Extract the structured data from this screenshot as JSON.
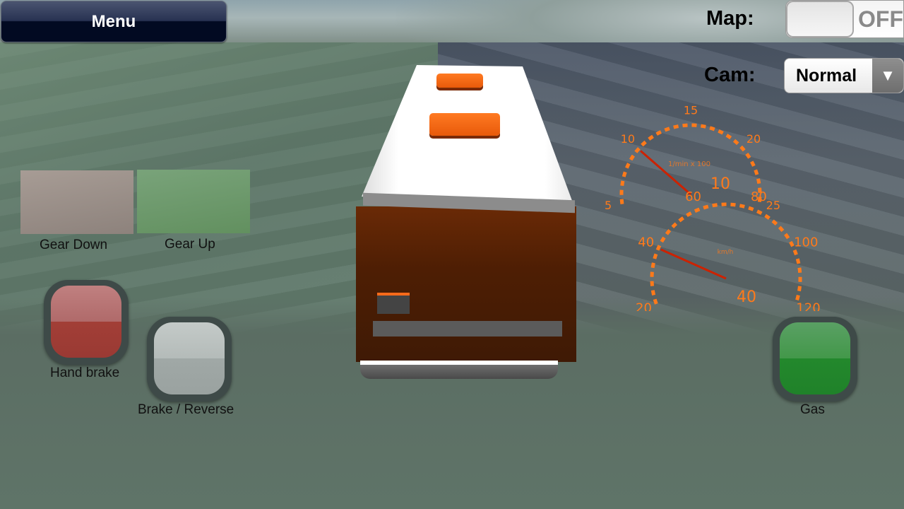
{
  "menu": {
    "label": "Menu"
  },
  "map": {
    "label": "Map:",
    "toggle_state": "OFF"
  },
  "cam": {
    "label": "Cam:",
    "selected": "Normal",
    "arrow_icon": "▼"
  },
  "controls": {
    "gear_down": {
      "label": "Gear Down",
      "color": "#9a8f89"
    },
    "gear_up": {
      "label": "Gear Up",
      "color": "#6e9a6c"
    },
    "hand_brake": {
      "label": "Hand brake",
      "color": "#a03a34"
    },
    "brake_reverse": {
      "label": "Brake / Reverse",
      "color": "#a9b0ae"
    },
    "gas": {
      "label": "Gas",
      "color": "#22882a"
    }
  },
  "tachometer": {
    "unit": "1/min x 100",
    "ticks": [
      "5",
      "10",
      "15",
      "20",
      "25"
    ],
    "min": 5,
    "max": 25,
    "value": 10,
    "readout": "10"
  },
  "speedometer": {
    "unit": "km/h",
    "ticks": [
      "20",
      "40",
      "60",
      "80",
      "100",
      "120"
    ],
    "min": 20,
    "max": 120,
    "value": 40,
    "readout": "40"
  },
  "colors": {
    "gauge": "#ff7a1a",
    "needle": "#cc2200",
    "menu_bg": "#020a22"
  }
}
